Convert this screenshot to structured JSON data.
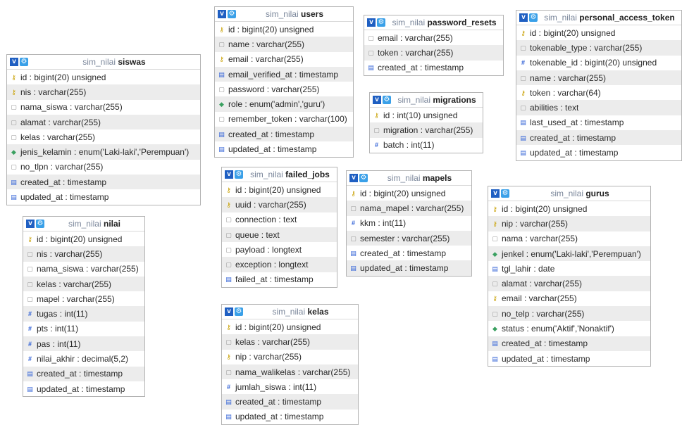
{
  "db_name": "sim_nilai",
  "icons": {
    "key": "primary-key-icon",
    "column": "column-icon",
    "number": "numeric-icon",
    "date": "date-icon",
    "enum": "enum-icon",
    "text": "text-icon",
    "header_v": "table-menu-icon",
    "header_gear": "settings-icon"
  },
  "tables": {
    "siswas": {
      "name": "siswas",
      "columns": [
        {
          "text": "id : bigint(20) unsigned",
          "icon": "key"
        },
        {
          "text": "nis : varchar(255)",
          "icon": "key"
        },
        {
          "text": "nama_siswa : varchar(255)",
          "icon": "column"
        },
        {
          "text": "alamat : varchar(255)",
          "icon": "column"
        },
        {
          "text": "kelas : varchar(255)",
          "icon": "column"
        },
        {
          "text": "jenis_kelamin : enum('Laki-laki','Perempuan')",
          "icon": "enum"
        },
        {
          "text": "no_tlpn : varchar(255)",
          "icon": "column"
        },
        {
          "text": "created_at : timestamp",
          "icon": "date"
        },
        {
          "text": "updated_at : timestamp",
          "icon": "date"
        }
      ]
    },
    "users": {
      "name": "users",
      "columns": [
        {
          "text": "id : bigint(20) unsigned",
          "icon": "key"
        },
        {
          "text": "name : varchar(255)",
          "icon": "column"
        },
        {
          "text": "email : varchar(255)",
          "icon": "key"
        },
        {
          "text": "email_verified_at : timestamp",
          "icon": "date"
        },
        {
          "text": "password : varchar(255)",
          "icon": "column"
        },
        {
          "text": "role : enum('admin','guru')",
          "icon": "enum"
        },
        {
          "text": "remember_token : varchar(100)",
          "icon": "column"
        },
        {
          "text": "created_at : timestamp",
          "icon": "date"
        },
        {
          "text": "updated_at : timestamp",
          "icon": "date"
        }
      ]
    },
    "password_resets": {
      "name": "password_resets",
      "columns": [
        {
          "text": "email : varchar(255)",
          "icon": "column"
        },
        {
          "text": "token : varchar(255)",
          "icon": "column"
        },
        {
          "text": "created_at : timestamp",
          "icon": "date"
        }
      ]
    },
    "personal_access_tokens": {
      "name": "personal_access_token",
      "columns": [
        {
          "text": "id : bigint(20) unsigned",
          "icon": "key"
        },
        {
          "text": "tokenable_type : varchar(255)",
          "icon": "column"
        },
        {
          "text": "tokenable_id : bigint(20) unsigned",
          "icon": "number"
        },
        {
          "text": "name : varchar(255)",
          "icon": "column"
        },
        {
          "text": "token : varchar(64)",
          "icon": "key"
        },
        {
          "text": "abilities : text",
          "icon": "text"
        },
        {
          "text": "last_used_at : timestamp",
          "icon": "date"
        },
        {
          "text": "created_at : timestamp",
          "icon": "date"
        },
        {
          "text": "updated_at : timestamp",
          "icon": "date"
        }
      ]
    },
    "migrations": {
      "name": "migrations",
      "columns": [
        {
          "text": "id : int(10) unsigned",
          "icon": "key"
        },
        {
          "text": "migration : varchar(255)",
          "icon": "column"
        },
        {
          "text": "batch : int(11)",
          "icon": "number"
        }
      ]
    },
    "failed_jobs": {
      "name": "failed_jobs",
      "columns": [
        {
          "text": "id : bigint(20) unsigned",
          "icon": "key"
        },
        {
          "text": "uuid : varchar(255)",
          "icon": "key"
        },
        {
          "text": "connection : text",
          "icon": "text"
        },
        {
          "text": "queue : text",
          "icon": "text"
        },
        {
          "text": "payload : longtext",
          "icon": "text"
        },
        {
          "text": "exception : longtext",
          "icon": "text"
        },
        {
          "text": "failed_at : timestamp",
          "icon": "date"
        }
      ]
    },
    "mapels": {
      "name": "mapels",
      "columns": [
        {
          "text": "id : bigint(20) unsigned",
          "icon": "key"
        },
        {
          "text": "nama_mapel : varchar(255)",
          "icon": "column"
        },
        {
          "text": "kkm : int(11)",
          "icon": "number"
        },
        {
          "text": "semester : varchar(255)",
          "icon": "column"
        },
        {
          "text": "created_at : timestamp",
          "icon": "date"
        },
        {
          "text": "updated_at : timestamp",
          "icon": "date"
        }
      ]
    },
    "gurus": {
      "name": "gurus",
      "columns": [
        {
          "text": "id : bigint(20) unsigned",
          "icon": "key"
        },
        {
          "text": "nip : varchar(255)",
          "icon": "key"
        },
        {
          "text": "nama : varchar(255)",
          "icon": "column"
        },
        {
          "text": "jenkel : enum('Laki-laki','Perempuan')",
          "icon": "enum"
        },
        {
          "text": "tgl_lahir : date",
          "icon": "date"
        },
        {
          "text": "alamat : varchar(255)",
          "icon": "column"
        },
        {
          "text": "email : varchar(255)",
          "icon": "key"
        },
        {
          "text": "no_telp : varchar(255)",
          "icon": "column"
        },
        {
          "text": "status : enum('Aktif','Nonaktif')",
          "icon": "enum"
        },
        {
          "text": "created_at : timestamp",
          "icon": "date"
        },
        {
          "text": "updated_at : timestamp",
          "icon": "date"
        }
      ]
    },
    "nilai": {
      "name": "nilai",
      "columns": [
        {
          "text": "id : bigint(20) unsigned",
          "icon": "key"
        },
        {
          "text": "nis : varchar(255)",
          "icon": "column"
        },
        {
          "text": "nama_siswa : varchar(255)",
          "icon": "column"
        },
        {
          "text": "kelas : varchar(255)",
          "icon": "column"
        },
        {
          "text": "mapel : varchar(255)",
          "icon": "column"
        },
        {
          "text": "tugas : int(11)",
          "icon": "number"
        },
        {
          "text": "pts : int(11)",
          "icon": "number"
        },
        {
          "text": "pas : int(11)",
          "icon": "number"
        },
        {
          "text": "nilai_akhir : decimal(5,2)",
          "icon": "number"
        },
        {
          "text": "created_at : timestamp",
          "icon": "date"
        },
        {
          "text": "updated_at : timestamp",
          "icon": "date"
        }
      ]
    },
    "kelas": {
      "name": "kelas",
      "columns": [
        {
          "text": "id : bigint(20) unsigned",
          "icon": "key"
        },
        {
          "text": "kelas : varchar(255)",
          "icon": "column"
        },
        {
          "text": "nip : varchar(255)",
          "icon": "key"
        },
        {
          "text": "nama_walikelas : varchar(255)",
          "icon": "column"
        },
        {
          "text": "jumlah_siswa : int(11)",
          "icon": "number"
        },
        {
          "text": "created_at : timestamp",
          "icon": "date"
        },
        {
          "text": "updated_at : timestamp",
          "icon": "date"
        }
      ]
    }
  }
}
